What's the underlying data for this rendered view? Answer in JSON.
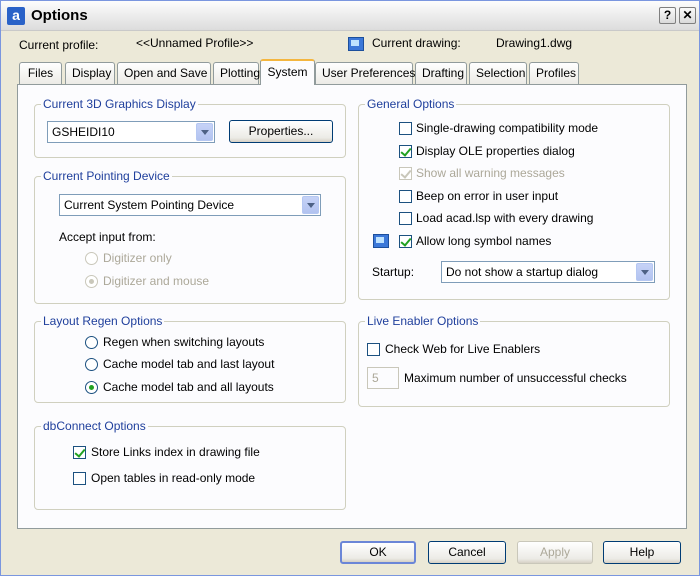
{
  "window": {
    "title": "Options",
    "app_icon_letter": "a",
    "help_glyph": "?",
    "close_glyph": "✕"
  },
  "profile": {
    "label": "Current profile:",
    "value": "<<Unnamed Profile>>",
    "drawing_label": "Current drawing:",
    "drawing_value": "Drawing1.dwg"
  },
  "tabs": [
    {
      "label": "Files"
    },
    {
      "label": "Display"
    },
    {
      "label": "Open and Save"
    },
    {
      "label": "Plotting"
    },
    {
      "label": "System"
    },
    {
      "label": "User Preferences"
    },
    {
      "label": "Drafting"
    },
    {
      "label": "Selection"
    },
    {
      "label": "Profiles"
    }
  ],
  "graphics": {
    "title": "Current 3D Graphics Display",
    "value": "GSHEIDI10",
    "properties_button": "Properties..."
  },
  "pointing": {
    "title": "Current Pointing Device",
    "value": "Current System Pointing Device",
    "accept_label": "Accept input from:",
    "options": [
      {
        "label": "Digitizer only",
        "checked": false
      },
      {
        "label": "Digitizer and mouse",
        "checked": true
      }
    ]
  },
  "layout_regen": {
    "title": "Layout Regen Options",
    "options": [
      {
        "label": "Regen when switching layouts",
        "checked": false
      },
      {
        "label": "Cache model tab and last layout",
        "checked": false
      },
      {
        "label": "Cache model tab and all layouts",
        "checked": true
      }
    ]
  },
  "dbconnect": {
    "title": "dbConnect Options",
    "options": [
      {
        "label": "Store Links index in drawing file",
        "checked": true
      },
      {
        "label": "Open tables in read-only mode",
        "checked": false
      }
    ]
  },
  "general": {
    "title": "General Options",
    "options": [
      {
        "label": "Single-drawing compatibility mode",
        "checked": false,
        "enabled": true
      },
      {
        "label": "Display OLE properties dialog",
        "checked": true,
        "enabled": true
      },
      {
        "label": "Show all warning messages",
        "checked": true,
        "enabled": false
      },
      {
        "label": "Beep on error in user input",
        "checked": false,
        "enabled": true
      },
      {
        "label": "Load acad.lsp with every drawing",
        "checked": false,
        "enabled": true
      },
      {
        "label": "Allow long symbol names",
        "checked": true,
        "enabled": true
      }
    ],
    "startup_label": "Startup:",
    "startup_value": "Do not show a startup dialog"
  },
  "live_enabler": {
    "title": "Live Enabler Options",
    "check_label": "Check Web for Live Enablers",
    "checked": false,
    "max_value": "5",
    "max_label": "Maximum number of unsuccessful checks"
  },
  "buttons": {
    "ok": "OK",
    "cancel": "Cancel",
    "apply": "Apply",
    "help": "Help"
  }
}
